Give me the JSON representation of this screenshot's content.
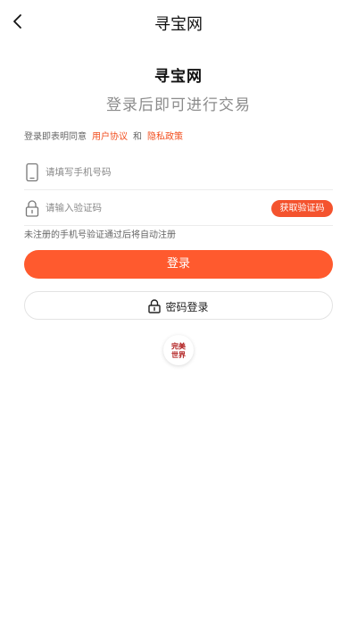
{
  "header": {
    "title": "寻宝网"
  },
  "brand": {
    "name": "寻宝网",
    "tagline": "登录后即可进行交易"
  },
  "agreement": {
    "prefix": "登录即表明同意",
    "user_agreement": "用户协议",
    "conjunction": "和",
    "privacy_policy": "隐私政策"
  },
  "form": {
    "phone_placeholder": "请填写手机号码",
    "code_placeholder": "请输入验证码",
    "get_code_label": "获取验证码",
    "hint": "未注册的手机号验证通过后将自动注册"
  },
  "buttons": {
    "login": "登录",
    "password_login": "密码登录"
  },
  "third_party": {
    "logo_text": "完美世界",
    "logo_icon": "perfect-world-logo"
  },
  "colors": {
    "accent": "#ff5a2e",
    "link": "#f24e1e"
  }
}
